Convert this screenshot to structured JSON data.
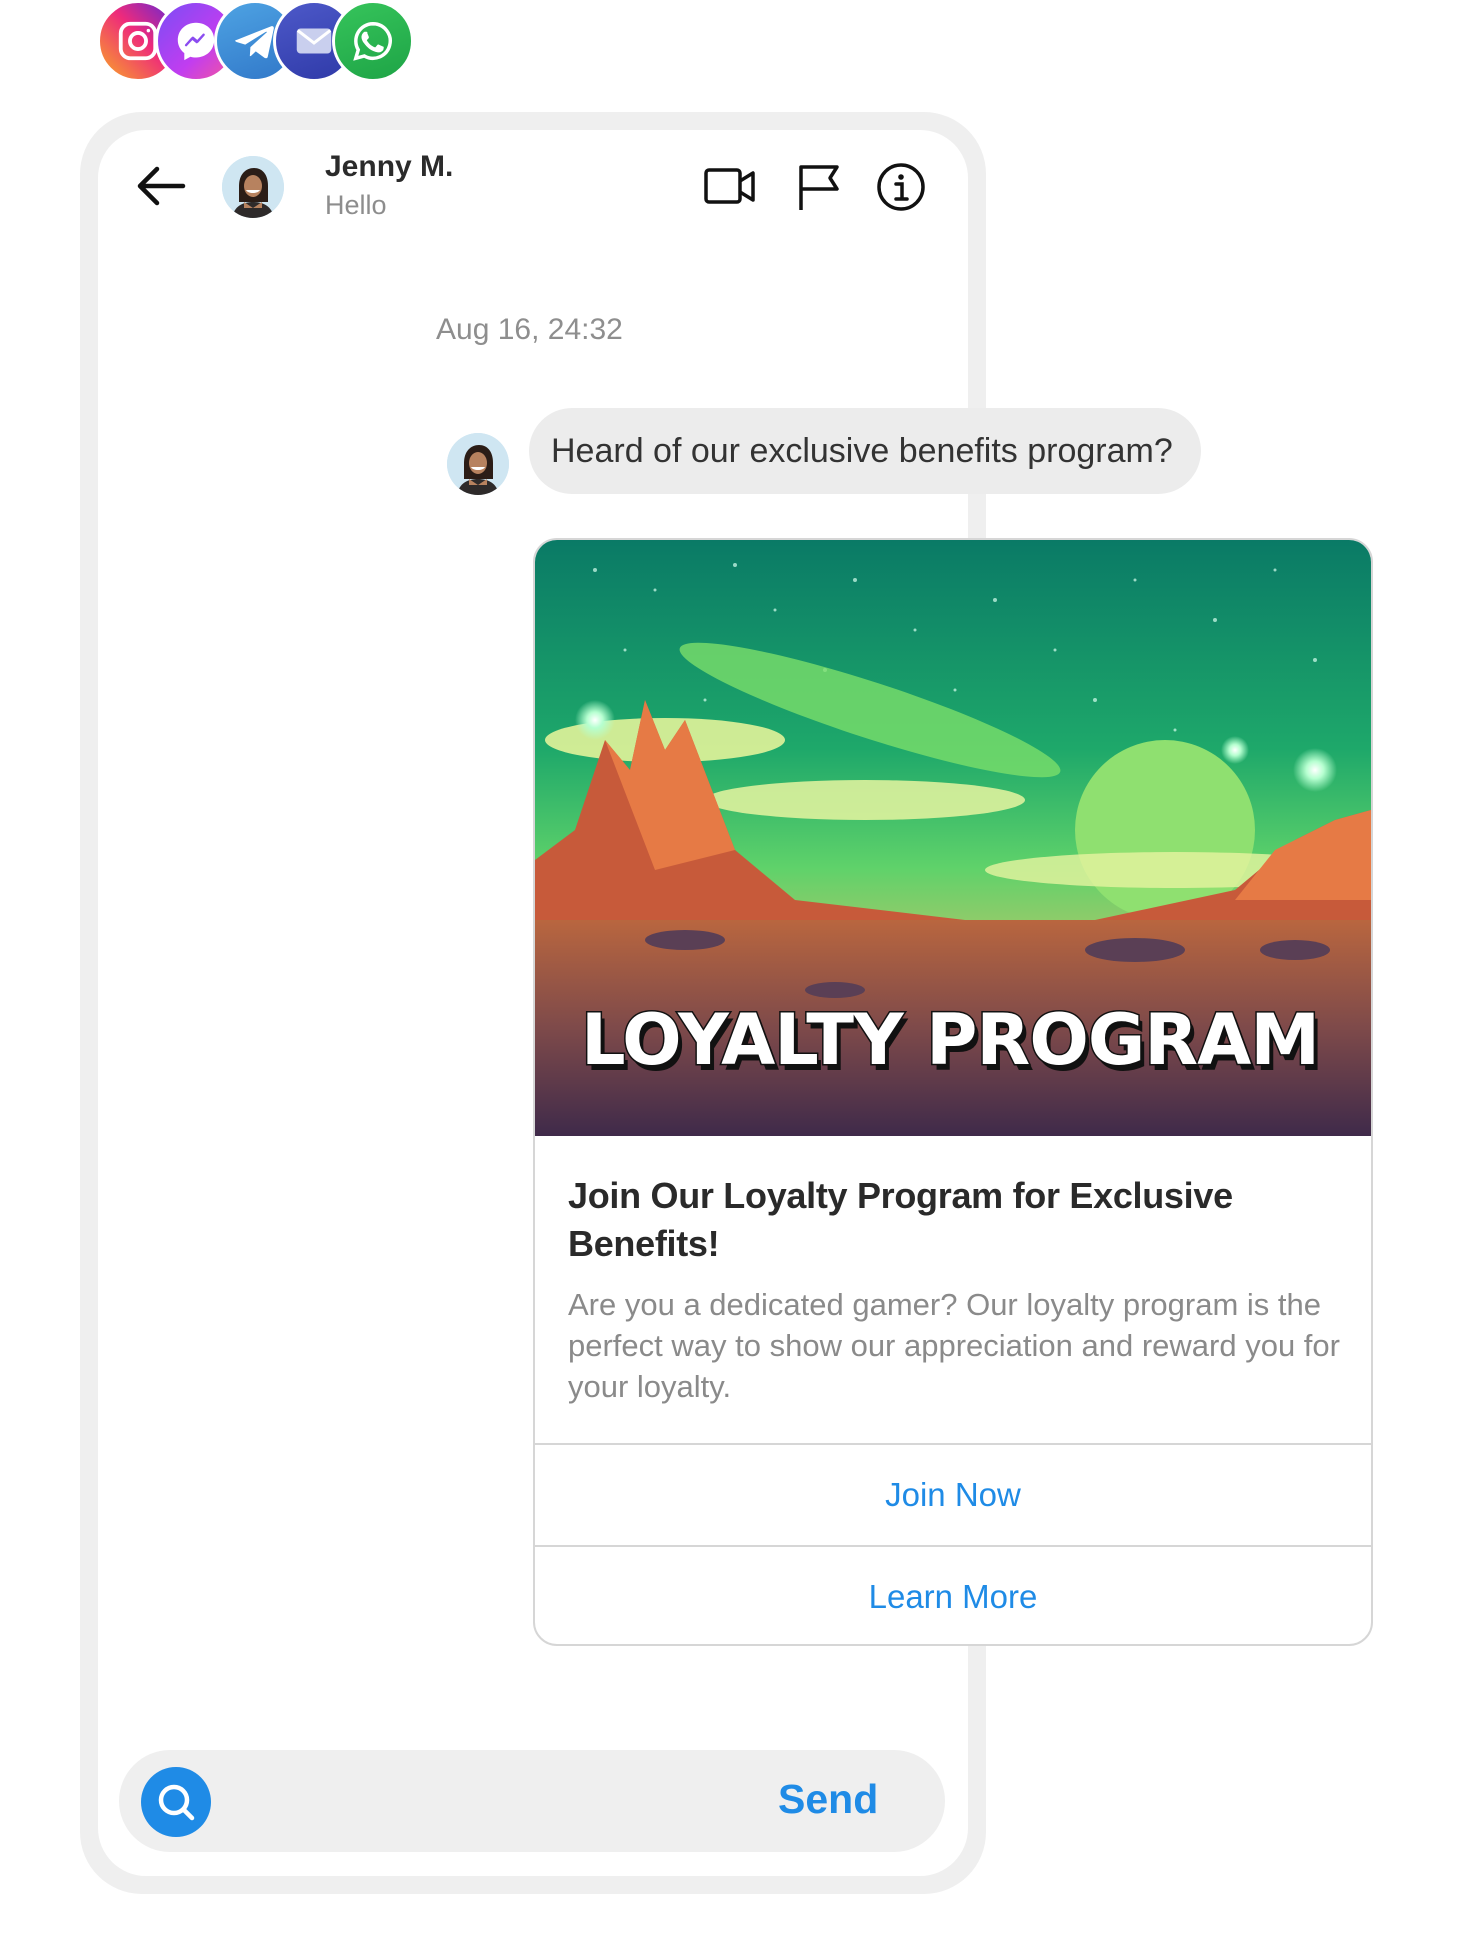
{
  "channels": [
    {
      "name": "instagram-icon",
      "color": "#ee2a7b"
    },
    {
      "name": "messenger-icon",
      "color": "#a64df0"
    },
    {
      "name": "telegram-icon",
      "color": "#3c8fd8"
    },
    {
      "name": "email-icon",
      "color": "#3a46b8"
    },
    {
      "name": "whatsapp-icon",
      "color": "#25b24f"
    }
  ],
  "header": {
    "back_icon": "arrow-left-icon",
    "contact_name": "Jenny M.",
    "contact_status": "Hello",
    "actions": [
      "video-icon",
      "flag-icon",
      "info-icon"
    ]
  },
  "conversation": {
    "timestamp": "Aug 16, 24:32",
    "message": "Heard of our exclusive benefits program?"
  },
  "card": {
    "image_caption": "LOYALTY PROGRAM",
    "title": "Join Our Loyalty Program for Exclusive Benefits!",
    "description": "Are you a dedicated gamer? Our loyalty program is the perfect way to show our appreciation and reward you for your loyalty.",
    "buttons": [
      {
        "label": "Join Now"
      },
      {
        "label": "Learn More"
      }
    ]
  },
  "composer": {
    "search_icon": "search-icon",
    "input_value": "",
    "send_label": "Send"
  },
  "colors": {
    "accent": "#1f8be6",
    "bubble": "#ececec",
    "frame": "#efefef"
  }
}
